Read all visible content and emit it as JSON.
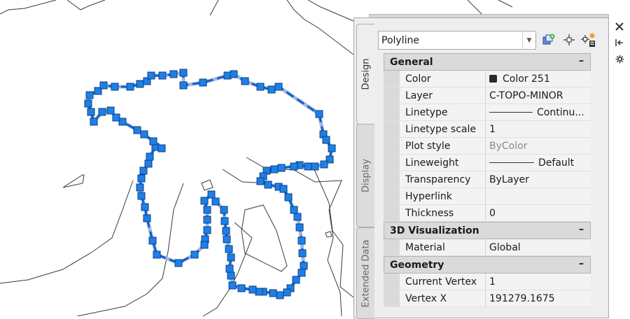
{
  "palette": {
    "object_type": "Polyline",
    "tabs": [
      {
        "label": "Design",
        "active": true
      },
      {
        "label": "Display",
        "active": false
      },
      {
        "label": "Extended Data",
        "active": false
      }
    ],
    "toolbar": {
      "quick_select_icon": "quick-select-icon",
      "select_objects_icon": "select-objects-icon",
      "toggle_pickadd_icon": "toggle-pickadd-icon"
    },
    "window_controls": {
      "close_icon": "close-icon",
      "autohide_icon": "autohide-icon",
      "settings_icon": "settings-icon"
    },
    "sections": [
      {
        "title": "General",
        "toggle": "–",
        "rows": [
          {
            "name": "Color",
            "value": "Color 251",
            "kind": "color"
          },
          {
            "name": "Layer",
            "value": "C-TOPO-MINOR"
          },
          {
            "name": "Linetype",
            "value": "Continu...",
            "kind": "linetype"
          },
          {
            "name": "Linetype scale",
            "value": "1"
          },
          {
            "name": "Plot style",
            "value": "ByColor",
            "dim": true
          },
          {
            "name": "Lineweight",
            "value": "Default",
            "kind": "lineweight"
          },
          {
            "name": "Transparency",
            "value": "ByLayer"
          },
          {
            "name": "Hyperlink",
            "value": ""
          },
          {
            "name": "Thickness",
            "value": "0"
          }
        ]
      },
      {
        "title": "3D Visualization",
        "toggle": "–",
        "rows": [
          {
            "name": "Material",
            "value": "Global"
          }
        ]
      },
      {
        "title": "Geometry",
        "toggle": "–",
        "rows": [
          {
            "name": "Current Vertex",
            "value": "1"
          },
          {
            "name": "Vertex X",
            "value": "191279.1675"
          }
        ]
      }
    ]
  },
  "colors": {
    "grip": "#1f7fe8",
    "grip_border": "#0b3f80",
    "selected_line": "#1560c8",
    "highlight_glow": "#9fb7e6",
    "drawing_line": "#3a3a3a",
    "background": "#ffffff"
  }
}
